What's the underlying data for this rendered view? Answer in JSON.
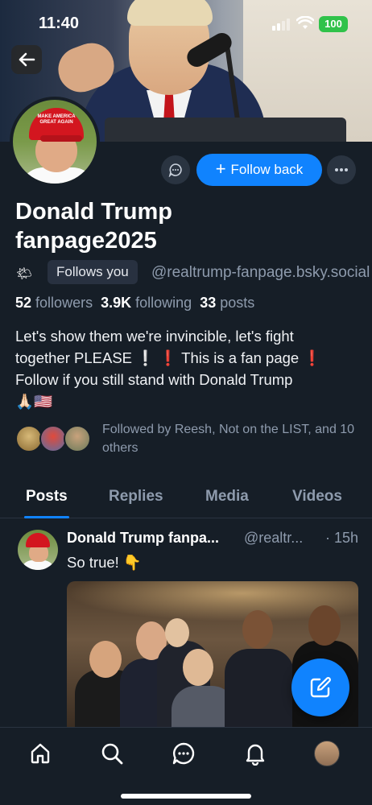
{
  "status_bar": {
    "time": "11:40",
    "battery": "100"
  },
  "profile": {
    "display_name_line1": "Donald Trump",
    "display_name_line2": "fanpage2025",
    "sun_emoji": "🌤",
    "follows_you_badge": "Follows you",
    "handle": "@realtrump-fanpage.bsky.social",
    "stats": {
      "followers_count": "52",
      "followers_label": "followers",
      "following_count": "3.9K",
      "following_label": "following",
      "posts_count": "33",
      "posts_label": "posts"
    },
    "bio_line1": "Let's show them we're invincible, let's fight",
    "bio_line2": "together PLEASE ❕   ❗ This is a fan page ❗",
    "bio_line3": "Follow if you still stand with Donald Trump",
    "bio_line4": "🙏🏻🇺🇸",
    "followed_by": "Followed by Reesh, Not on the LIST, and 10 others",
    "avatar_cap_text": "MAKE AMERICA GREAT AGAIN"
  },
  "actions": {
    "follow_back_label": "Follow back",
    "follow_plus": "+"
  },
  "tabs": [
    {
      "label": "Posts",
      "active": true
    },
    {
      "label": "Replies",
      "active": false
    },
    {
      "label": "Media",
      "active": false
    },
    {
      "label": "Videos",
      "active": false
    }
  ],
  "post": {
    "author": "Donald Trump fanpa...",
    "handle": "@realtr...",
    "time": "· 15h",
    "text": "So true! 👇"
  },
  "bottom_nav": [
    "home-icon",
    "search-icon",
    "chat-icon",
    "bell-icon",
    "profile-avatar"
  ],
  "colors": {
    "accent": "#1083fe",
    "background": "#161e27",
    "muted": "#8e9bad",
    "battery": "#30c24a"
  }
}
